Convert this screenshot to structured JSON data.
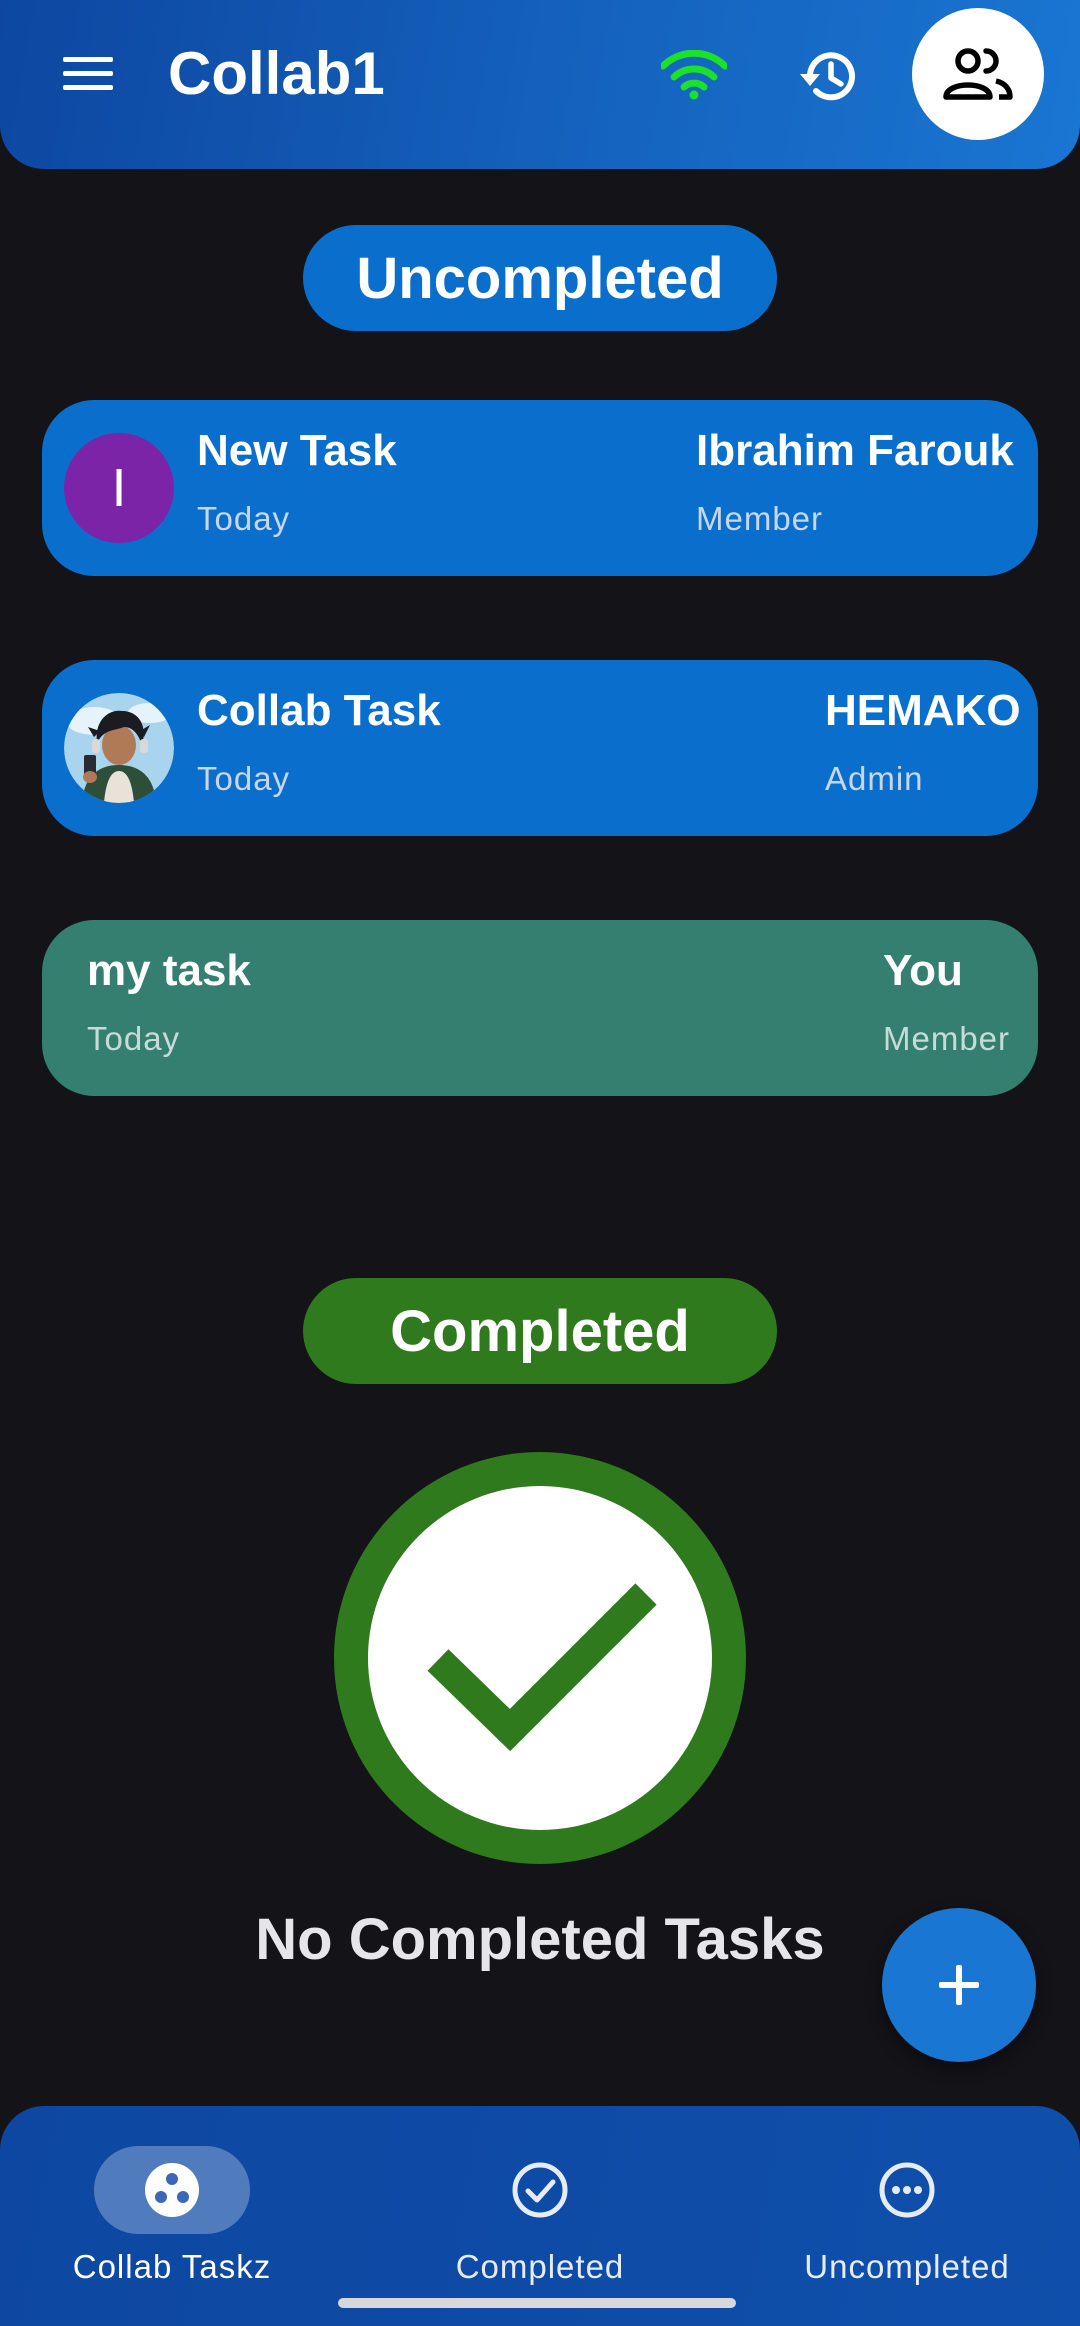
{
  "header": {
    "title": "Collab1",
    "icons": {
      "menu": "menu-icon",
      "wifi": "wifi-icon",
      "history": "history-icon",
      "members": "group-icon"
    },
    "wifi_color": "#1de02a"
  },
  "sections": {
    "uncompleted_label": "Uncompleted",
    "completed_label": "Completed"
  },
  "tasks": [
    {
      "title": "New Task",
      "date": "Today",
      "owner": "Ibrahim Farouk",
      "role": "Member",
      "avatar_letter": "I",
      "avatar_color": "#7b24a8",
      "card_color": "#0a6fcc"
    },
    {
      "title": "Collab Task",
      "date": "Today",
      "owner": "HEMAKO",
      "role": "Admin",
      "avatar": "user-photo-avatar",
      "card_color": "#0a6fcc"
    },
    {
      "title": "my task",
      "date": "Today",
      "owner": "You",
      "role": "Member",
      "card_color": "#357f71"
    }
  ],
  "completed_empty": {
    "icon": "check-circle-icon",
    "message": "No Completed Tasks"
  },
  "fab": {
    "icon": "plus-icon"
  },
  "bottom_nav": [
    {
      "label": "Collab Taskz",
      "icon": "collab-dots-icon",
      "active": true
    },
    {
      "label": "Completed",
      "icon": "check-circle-outline-icon",
      "active": false
    },
    {
      "label": "Uncompleted",
      "icon": "more-horizontal-circle-icon",
      "active": false
    }
  ],
  "colors": {
    "background": "#141318",
    "header": "#1565c0",
    "card_blue": "#0a6fcc",
    "card_green": "#357f71",
    "completed_green": "#2e7a1c"
  }
}
